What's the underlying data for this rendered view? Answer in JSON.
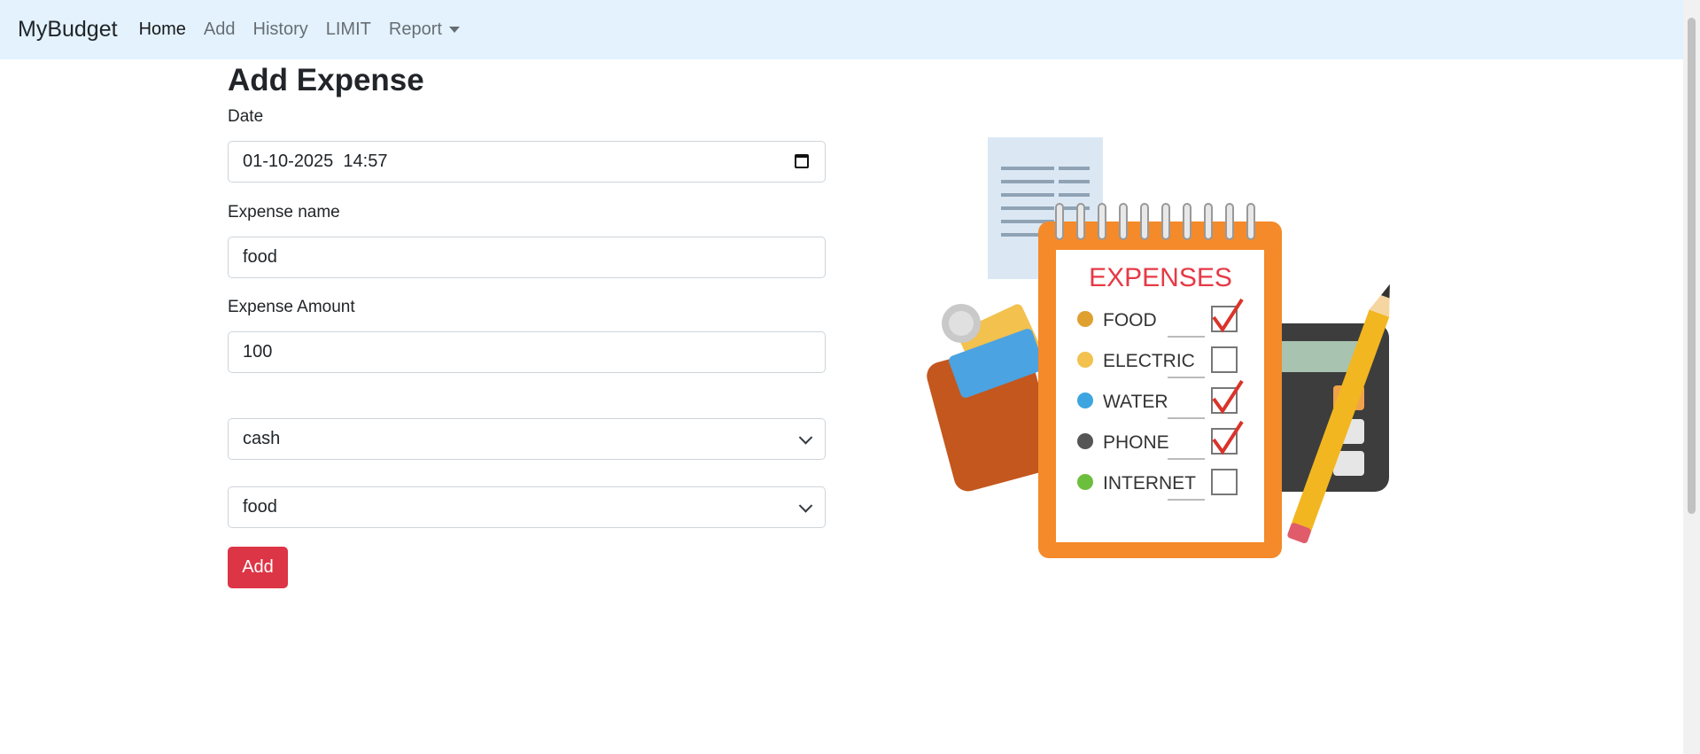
{
  "navbar": {
    "brand": "MyBudget",
    "items": [
      {
        "label": "Home"
      },
      {
        "label": "Add"
      },
      {
        "label": "History"
      },
      {
        "label": "LIMIT"
      },
      {
        "label": "Report"
      }
    ]
  },
  "form": {
    "title": "Add Expense",
    "date_label": "Date",
    "date_value": "01-10-2025  14:57",
    "name_label": "Expense name",
    "name_value": "food",
    "amount_label": "Expense Amount",
    "amount_value": "100",
    "payment_select": "cash",
    "category_select": "food",
    "submit_label": "Add"
  },
  "illustration": {
    "heading": "EXPENSES",
    "items": [
      "FOOD",
      "ELECTRIC",
      "WATER",
      "PHONE",
      "INTERNET"
    ],
    "checked": [
      true,
      false,
      true,
      true,
      false
    ]
  }
}
